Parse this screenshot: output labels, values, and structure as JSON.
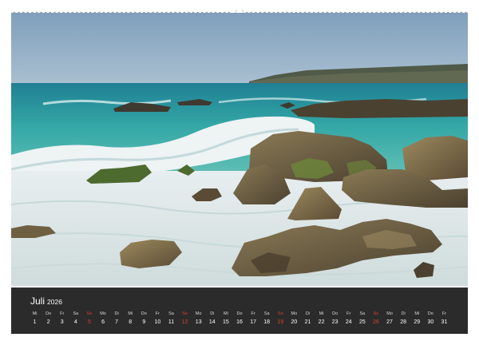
{
  "calendar": {
    "month": "Juli",
    "year": "2026",
    "days": [
      {
        "n": "Mi",
        "d": "1"
      },
      {
        "n": "Do",
        "d": "2"
      },
      {
        "n": "Fr",
        "d": "3"
      },
      {
        "n": "Sa",
        "d": "4"
      },
      {
        "n": "So",
        "d": "5",
        "sun": true
      },
      {
        "n": "Mo",
        "d": "6"
      },
      {
        "n": "Di",
        "d": "7"
      },
      {
        "n": "Mi",
        "d": "8"
      },
      {
        "n": "Do",
        "d": "9"
      },
      {
        "n": "Fr",
        "d": "10"
      },
      {
        "n": "Sa",
        "d": "11"
      },
      {
        "n": "So",
        "d": "12",
        "sun": true
      },
      {
        "n": "Mo",
        "d": "13"
      },
      {
        "n": "Di",
        "d": "14"
      },
      {
        "n": "Mi",
        "d": "15"
      },
      {
        "n": "Do",
        "d": "16"
      },
      {
        "n": "Fr",
        "d": "17"
      },
      {
        "n": "Sa",
        "d": "18"
      },
      {
        "n": "So",
        "d": "19",
        "sun": true
      },
      {
        "n": "Mo",
        "d": "20"
      },
      {
        "n": "Di",
        "d": "21"
      },
      {
        "n": "Mi",
        "d": "22"
      },
      {
        "n": "Do",
        "d": "23"
      },
      {
        "n": "Fr",
        "d": "24"
      },
      {
        "n": "Sa",
        "d": "25"
      },
      {
        "n": "So",
        "d": "26",
        "sun": true
      },
      {
        "n": "Mo",
        "d": "27"
      },
      {
        "n": "Di",
        "d": "28"
      },
      {
        "n": "Mi",
        "d": "29"
      },
      {
        "n": "Do",
        "d": "30"
      },
      {
        "n": "Fr",
        "d": "31"
      }
    ]
  },
  "colors": {
    "bar": "#2b2b2b",
    "sunday": "#e0402e",
    "sea": "#2fa3a3",
    "sky": "#8aa9c2"
  },
  "photo": {
    "subject": "seascape-rocky-coast"
  }
}
